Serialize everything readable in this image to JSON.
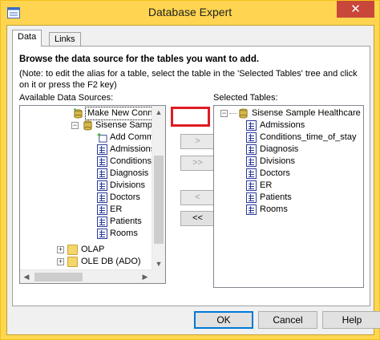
{
  "window": {
    "title": "Database Expert",
    "close_glyph": "✕"
  },
  "tabs": [
    {
      "label": "Data",
      "active": true
    },
    {
      "label": "Links",
      "active": false
    }
  ],
  "panel": {
    "heading": "Browse the data source for the tables you want to add.",
    "note": "(Note: to edit the alias for a table, select the table in the 'Selected Tables' tree and click on it or press the F2 key)",
    "available_label": "Available Data Sources:",
    "selected_label": "Selected Tables:"
  },
  "available_tree": [
    {
      "label": "Make New Connec",
      "icon": "new-connection-icon",
      "selected": true
    },
    {
      "label": "Sisense Sample He",
      "icon": "database-icon",
      "expander": "−"
    },
    {
      "label": "Add Command",
      "icon": "add-command-icon"
    },
    {
      "label": "Admissions",
      "icon": "table-icon"
    },
    {
      "label": "Conditions_time",
      "icon": "table-icon"
    },
    {
      "label": "Diagnosis",
      "icon": "table-icon"
    },
    {
      "label": "Divisions",
      "icon": "table-icon"
    },
    {
      "label": "Doctors",
      "icon": "table-icon"
    },
    {
      "label": "ER",
      "icon": "table-icon"
    },
    {
      "label": "Patients",
      "icon": "table-icon"
    },
    {
      "label": "Rooms",
      "icon": "table-icon"
    },
    {
      "label": "OLAP",
      "icon": "folder-icon",
      "expander": "+"
    },
    {
      "label": "OLE DB (ADO)",
      "icon": "folder-icon",
      "expander": "+"
    }
  ],
  "selected_tree": {
    "root": {
      "label": "Sisense Sample Healthcare",
      "icon": "database-icon",
      "expander": "−"
    },
    "tables": [
      "Admissions",
      "Conditions_time_of_stay",
      "Diagnosis",
      "Divisions",
      "Doctors",
      "ER",
      "Patients",
      "Rooms"
    ]
  },
  "transfer_buttons": [
    {
      "label": ">",
      "enabled": false,
      "name": "add-button"
    },
    {
      "label": ">>",
      "enabled": false,
      "name": "add-all-button"
    },
    {
      "label": "<",
      "enabled": false,
      "name": "remove-button"
    },
    {
      "label": "<<",
      "enabled": true,
      "name": "remove-all-button"
    }
  ],
  "dialog_buttons": {
    "ok": "OK",
    "cancel": "Cancel",
    "help": "Help"
  },
  "scroll_glyphs": {
    "up": "▲",
    "down": "▼",
    "left": "◀",
    "right": "▶"
  },
  "colors": {
    "titlebar": "#ffd451",
    "close": "#c8473a",
    "highlight": "#e01b24",
    "table_icon": "#2b3a9a"
  }
}
